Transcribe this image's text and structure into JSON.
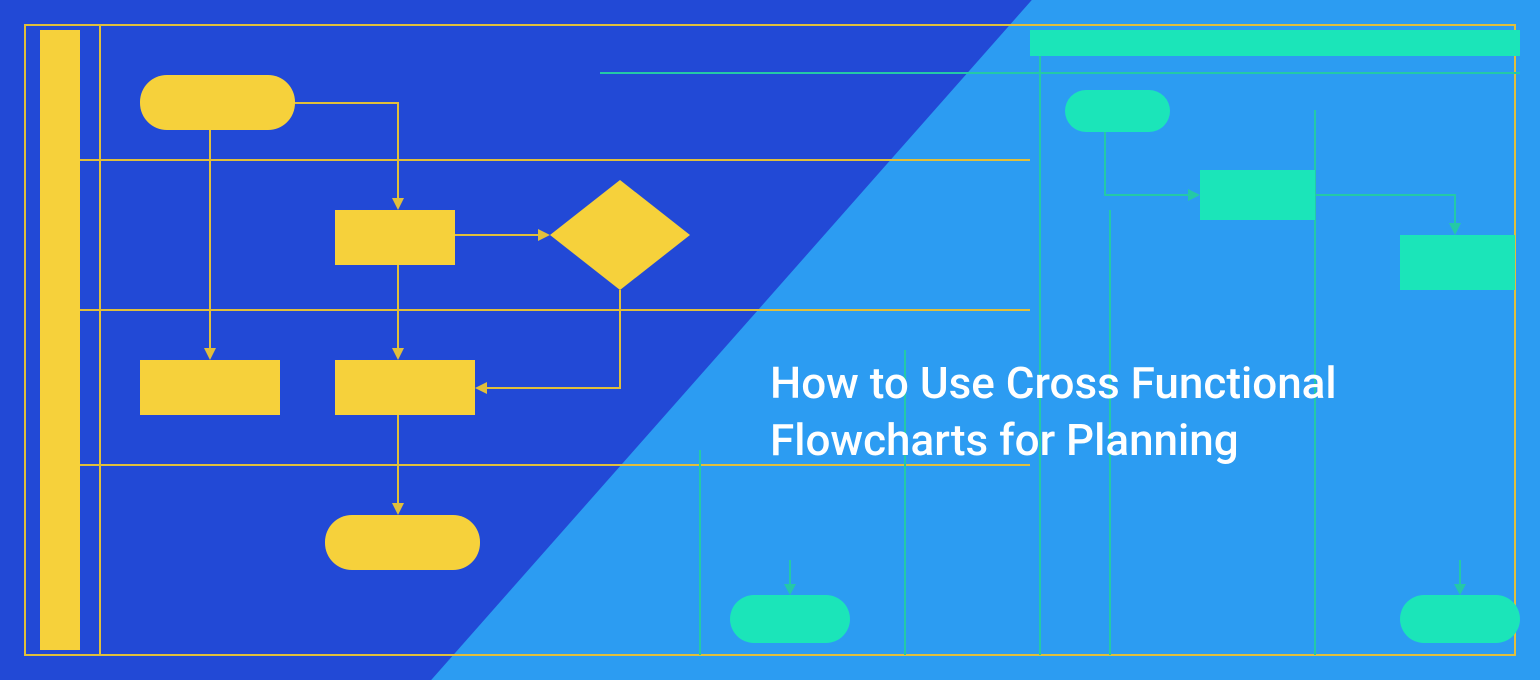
{
  "title_line1": "How to Use Cross Functional",
  "title_line2": "Flowcharts for Planning",
  "colors": {
    "bg_left": "#2249D6",
    "bg_right": "#2C9CF2",
    "yellow": "#F6D13B",
    "yellow_line": "#E1BF3B",
    "teal": "#1BE5B9",
    "teal_line": "#24C9A7",
    "white": "#FFFFFF"
  }
}
